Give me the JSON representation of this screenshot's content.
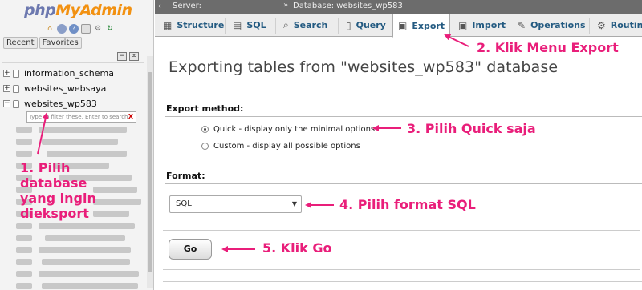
{
  "nav": {
    "logo_php": "php",
    "logo_myadmin": "MyAdmin",
    "tabs": [
      "Recent",
      "Favorites"
    ],
    "databases": [
      {
        "name": "information_schema",
        "expander": "+"
      },
      {
        "name": "websites_websaya",
        "expander": "+"
      },
      {
        "name": "websites_wp583",
        "expander": "−"
      }
    ],
    "filter_placeholder": "Type to filter these, Enter to search",
    "filter_clear": "X",
    "collapse_symbol": "−",
    "link_symbol": "∞"
  },
  "serverbar": {
    "back": "←",
    "server": "Server:",
    "separator": "»",
    "database": "Database: websites_wp583"
  },
  "tabs": [
    {
      "label": "Structure",
      "icon": "structure-icon"
    },
    {
      "label": "SQL",
      "icon": "sql-icon"
    },
    {
      "label": "Search",
      "icon": "search-icon"
    },
    {
      "label": "Query",
      "icon": "query-icon"
    },
    {
      "label": "Export",
      "icon": "export-icon",
      "active": true
    },
    {
      "label": "Import",
      "icon": "import-icon"
    },
    {
      "label": "Operations",
      "icon": "operations-icon"
    },
    {
      "label": "Routines",
      "icon": "routines-icon"
    }
  ],
  "main": {
    "title": "Exporting tables from \"websites_wp583\" database",
    "export_method_label": "Export method:",
    "method_options": [
      {
        "label": "Quick - display only the minimal options",
        "selected": true
      },
      {
        "label": "Custom - display all possible options",
        "selected": false
      }
    ],
    "format_label": "Format:",
    "format_value": "SQL",
    "format_arrow": "▼",
    "go_label": "Go"
  },
  "annotations": {
    "step1_line1": "1. Pilih",
    "step1_line2": "database",
    "step1_line3": "yang ingin",
    "step1_line4": "dieksport",
    "step2": "2. Klik Menu Export",
    "step3": "3. Pilih Quick saja",
    "step4": "4. Pilih format SQL",
    "step5": "5. Klik Go"
  },
  "colors": {
    "annotation": "#e91e7a",
    "tab_text": "#235a81",
    "logo_php": "#6c78af",
    "logo_myadmin": "#f29111",
    "serverbar_bg": "#6c6c6c"
  }
}
